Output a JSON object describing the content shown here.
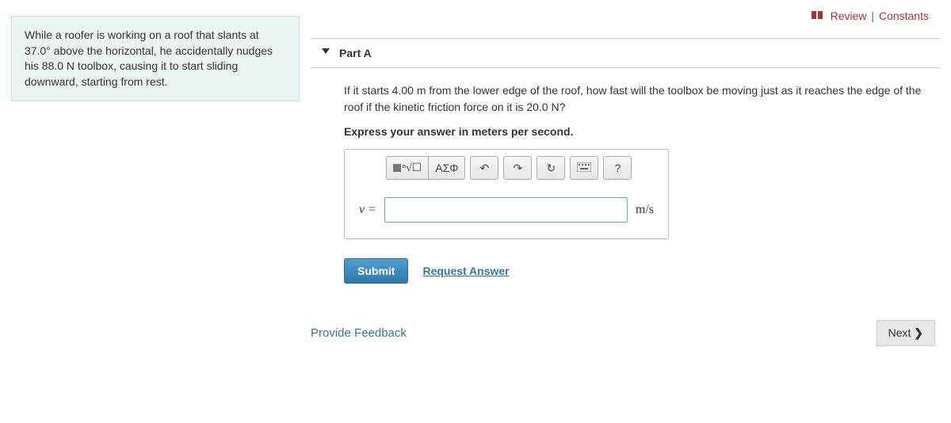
{
  "top": {
    "review": "Review",
    "constants": "Constants"
  },
  "problem": {
    "text": "While a roofer is working on a roof that slants at 37.0° above the horizontal, he accidentally nudges his 88.0 N toolbox, causing it to start sliding downward, starting from rest."
  },
  "part": {
    "label": "Part A",
    "question": "If it starts 4.00 m from the lower edge of the roof, how fast will the toolbox be moving just as it reaches the edge of the roof if the kinetic friction force on it is 20.0 N?",
    "instruction": "Express your answer in meters per second."
  },
  "toolbar": {
    "template": "template",
    "root": "√",
    "greek": "ΑΣΦ",
    "undo": "↶",
    "redo": "↷",
    "reset": "↻",
    "keyboard": "⌨",
    "help": "?"
  },
  "answer": {
    "var": "v =",
    "value": "",
    "unit": "m/s"
  },
  "actions": {
    "submit": "Submit",
    "request": "Request Answer"
  },
  "footer": {
    "feedback": "Provide Feedback",
    "next": "Next"
  }
}
